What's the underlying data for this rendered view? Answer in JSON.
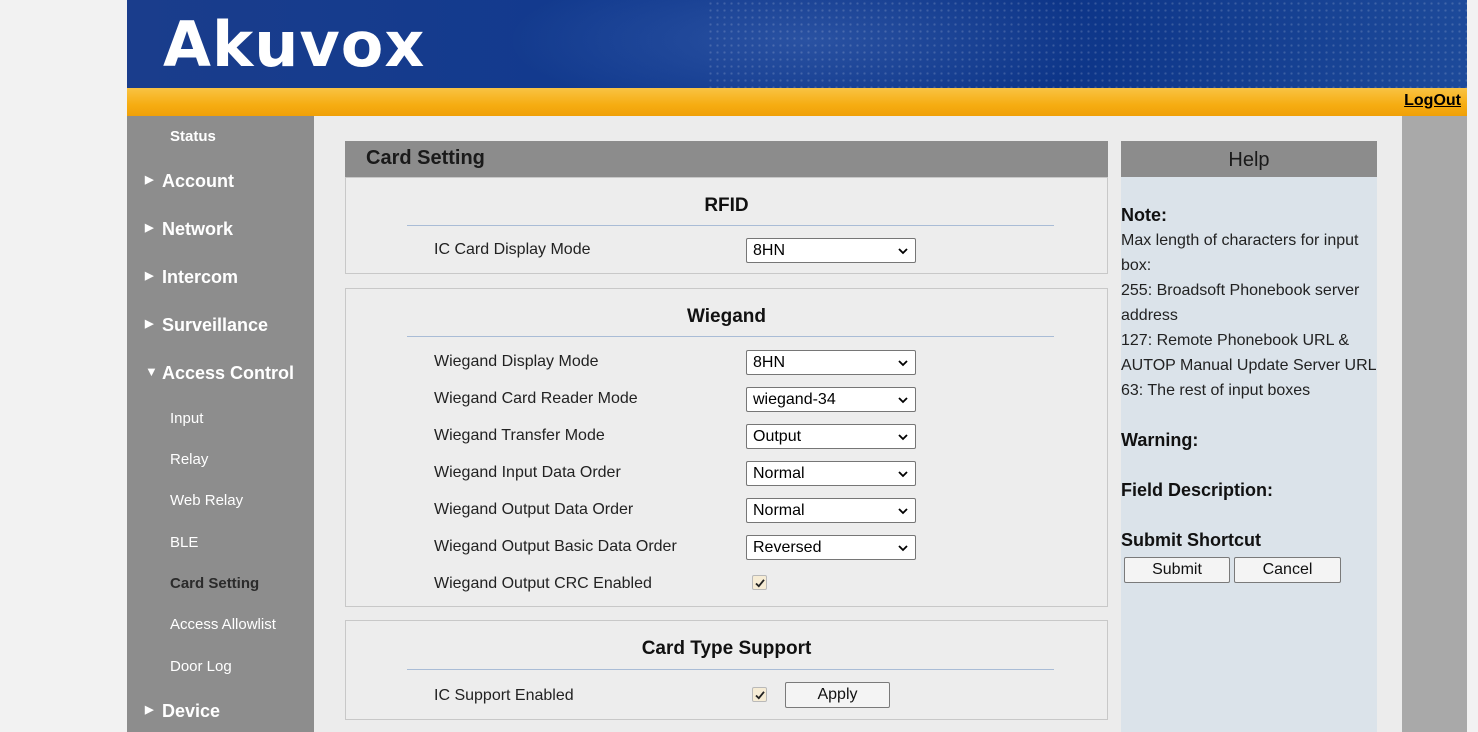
{
  "header": {
    "logo": "Akuvox",
    "logout_label": "LogOut"
  },
  "sidebar": {
    "status": "Status",
    "main_items": [
      "Account",
      "Network",
      "Intercom",
      "Surveillance",
      "Access Control",
      "Device"
    ],
    "access_control_sub": [
      "Input",
      "Relay",
      "Web Relay",
      "BLE",
      "Card Setting",
      "Access Allowlist",
      "Door Log"
    ],
    "active_item": "Card Setting"
  },
  "panel": {
    "title": "Card Setting",
    "rfid": {
      "title": "RFID",
      "ic_card_display_mode": {
        "label": "IC Card Display Mode",
        "value": "8HN"
      }
    },
    "wiegand": {
      "title": "Wiegand",
      "display_mode": {
        "label": "Wiegand Display Mode",
        "value": "8HN"
      },
      "card_reader_mode": {
        "label": "Wiegand Card Reader Mode",
        "value": "wiegand-34"
      },
      "transfer_mode": {
        "label": "Wiegand Transfer Mode",
        "value": "Output"
      },
      "input_data_order": {
        "label": "Wiegand Input Data Order",
        "value": "Normal"
      },
      "output_data_order": {
        "label": "Wiegand Output Data Order",
        "value": "Normal"
      },
      "output_basic_data_order": {
        "label": "Wiegand Output Basic Data Order",
        "value": "Reversed"
      },
      "output_crc_enabled": {
        "label": "Wiegand Output CRC Enabled",
        "checked": true
      }
    },
    "card_type": {
      "title": "Card Type Support",
      "ic_support_enabled": {
        "label": "IC Support Enabled",
        "checked": true
      },
      "apply_label": "Apply"
    }
  },
  "help": {
    "title": "Help",
    "note_heading": "Note:",
    "note_lines": [
      "Max length of characters for input",
      "box:",
      "255: Broadsoft Phonebook server",
      "address",
      "127: Remote Phonebook URL &",
      "AUTOP Manual Update Server URL",
      "63: The rest of input boxes"
    ],
    "warning_heading": "Warning:",
    "field_description_heading": "Field Description:",
    "submit_shortcut_heading": "Submit Shortcut",
    "submit_label": "Submit",
    "cancel_label": "Cancel"
  },
  "colors": {
    "header_blue": "#123a8e",
    "yellow_bar": "#f6ad12",
    "sidebar_gray": "#8d8d8d",
    "help_bg": "#dbe3ea"
  }
}
